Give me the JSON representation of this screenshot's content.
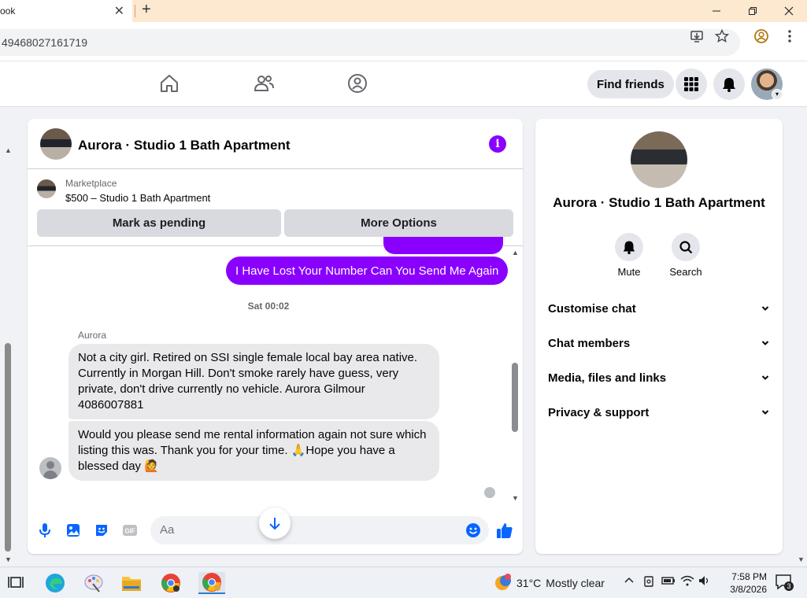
{
  "browser": {
    "tab_title": "ook",
    "tab_close": "✕",
    "new_tab": "+",
    "url": "49468027161719"
  },
  "fbnav": {
    "find_friends": "Find friends"
  },
  "chat": {
    "title": "Aurora · Studio 1 Bath Apartment",
    "marketplace_label": "Marketplace",
    "listing": "$500 – Studio 1 Bath Apartment",
    "mark_pending": "Mark as pending",
    "more_options": "More Options",
    "outgoing_message": "I Have Lost Your Number Can You Send Me Again",
    "timestamp": "Sat 00:02",
    "sender_name": "Aurora",
    "incoming_1": "Not a city girl. Retired on SSI single female local bay area native. Currently in Morgan Hill. Don't smoke rarely have guess, very private, don't drive currently no vehicle. Aurora Gilmour 4086007881",
    "incoming_2": "Would you please send me rental information again not sure which listing this was. Thank you for your time. 🙏Hope you have a blessed day 🙋",
    "composer_placeholder": "Aa",
    "accent_color": "#8a00ff"
  },
  "side": {
    "title": "Aurora · Studio 1 Bath Apartment",
    "actions": [
      {
        "label": "Mute",
        "icon": "bell-icon"
      },
      {
        "label": "Search",
        "icon": "search-icon"
      }
    ],
    "sections": [
      {
        "label": "Customise chat"
      },
      {
        "label": "Chat members"
      },
      {
        "label": "Media, files and links"
      },
      {
        "label": "Privacy & support"
      }
    ]
  },
  "taskbar": {
    "temperature": "31°C",
    "weather": "Mostly clear",
    "time": "7:58 PM",
    "date": "3/8/2026",
    "notifications": "3"
  }
}
